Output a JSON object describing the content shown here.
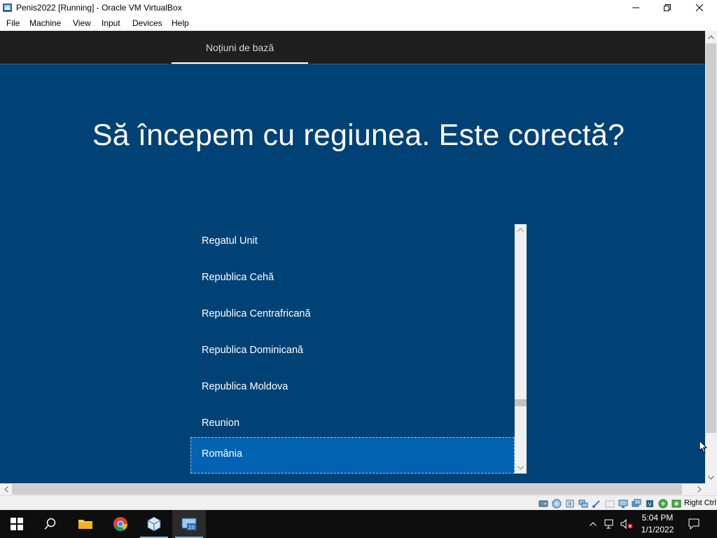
{
  "window": {
    "title": "Penis2022 [Running] - Oracle VM VirtualBox"
  },
  "menu": {
    "items": [
      "File",
      "Machine",
      "View",
      "Input",
      "Devices",
      "Help"
    ]
  },
  "oobe": {
    "tab_label": "Noțiuni de bază",
    "heading": "Să începem cu regiunea. Este corectă?",
    "regions": [
      "Regatul Unit",
      "Republica Cehă",
      "Republica Centrafricană",
      "Republica Dominicană",
      "Republica Moldova",
      "Reunion",
      "România"
    ],
    "selected_region": "România"
  },
  "statusbar": {
    "host_key": "Right Ctrl",
    "icons": [
      "hard-disk-icon",
      "optical-drive-icon",
      "audio-icon",
      "network-icon",
      "usb-icon",
      "shared-folders-icon",
      "display-icon",
      "video-capture-icon",
      "cpu-icon",
      "mouse-integration-icon",
      "keyboard-icon"
    ]
  },
  "taskbar": {
    "apps": [
      "start-icon",
      "search-icon",
      "file-explorer-icon",
      "chrome-icon",
      "virtualbox-icon",
      "virtualbox-vm-icon"
    ],
    "time": "5:04 PM",
    "date": "1/1/2022"
  },
  "colors": {
    "oobe_background": "#004275",
    "oobe_header": "#1f1f1f",
    "selected_item": "#0063b1",
    "taskbar": "#0e0e0e"
  }
}
